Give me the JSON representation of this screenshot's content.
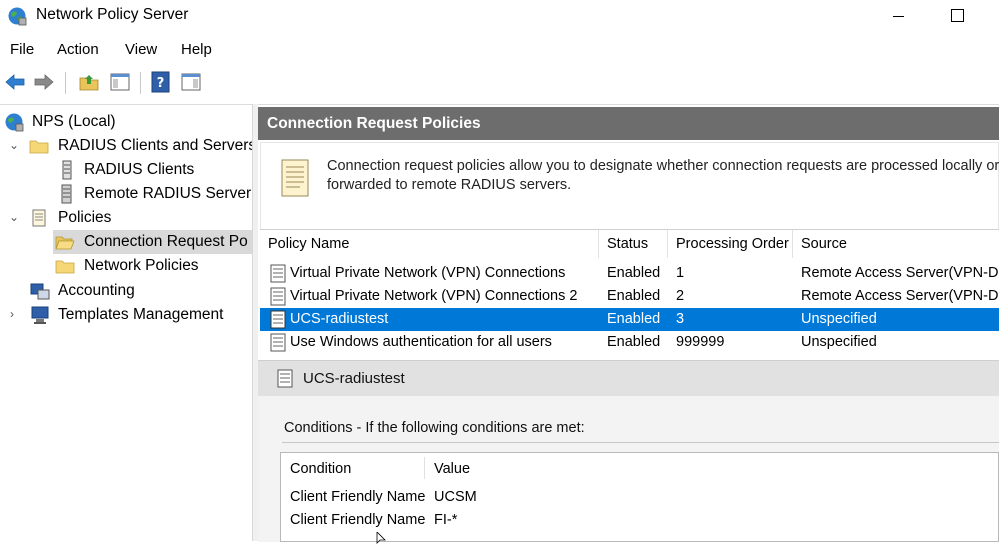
{
  "window": {
    "title": "Network Policy Server"
  },
  "menu": [
    "File",
    "Action",
    "View",
    "Help"
  ],
  "toolbar": [
    "back-arrow-icon",
    "forward-arrow-icon",
    "up-folder-icon",
    "show-hide-tree-icon",
    "help-icon",
    "action-pane-icon"
  ],
  "tree": {
    "root": "NPS (Local)",
    "radius_group": "RADIUS Clients and Servers",
    "radius_clients": "RADIUS Clients",
    "remote_radius": "Remote RADIUS Server",
    "policies": "Policies",
    "connection_request": "Connection Request Po",
    "network_policies": "Network Policies",
    "accounting": "Accounting",
    "templates": "Templates Management"
  },
  "header": {
    "title": "Connection Request Policies"
  },
  "info": {
    "text": "Connection request policies allow you to designate whether connection requests are processed locally or forwarded to remote RADIUS servers."
  },
  "grid": {
    "columns": [
      "Policy Name",
      "Status",
      "Processing Order",
      "Source"
    ],
    "rows": [
      {
        "name": "Virtual Private Network (VPN) Connections",
        "status": "Enabled",
        "order": "1",
        "source": "Remote Access Server(VPN-Di"
      },
      {
        "name": "Virtual Private Network (VPN) Connections 2",
        "status": "Enabled",
        "order": "2",
        "source": "Remote Access Server(VPN-Di"
      },
      {
        "name": "UCS-radiustest",
        "status": "Enabled",
        "order": "3",
        "source": "Unspecified"
      },
      {
        "name": "Use Windows authentication for all users",
        "status": "Enabled",
        "order": "999999",
        "source": "Unspecified"
      }
    ],
    "selected_index": 2
  },
  "detail": {
    "title": "UCS-radiustest",
    "conditions_label": "Conditions - If the following conditions are met:",
    "columns": [
      "Condition",
      "Value"
    ],
    "conditions": [
      {
        "condition": "Client Friendly Name",
        "value": "UCSM"
      },
      {
        "condition": "Client Friendly Name",
        "value": "FI-*"
      }
    ]
  },
  "colors": {
    "selection": "#0078d7",
    "header_bg": "#6d6d6d",
    "detail_bar": "#e1e1e1"
  }
}
